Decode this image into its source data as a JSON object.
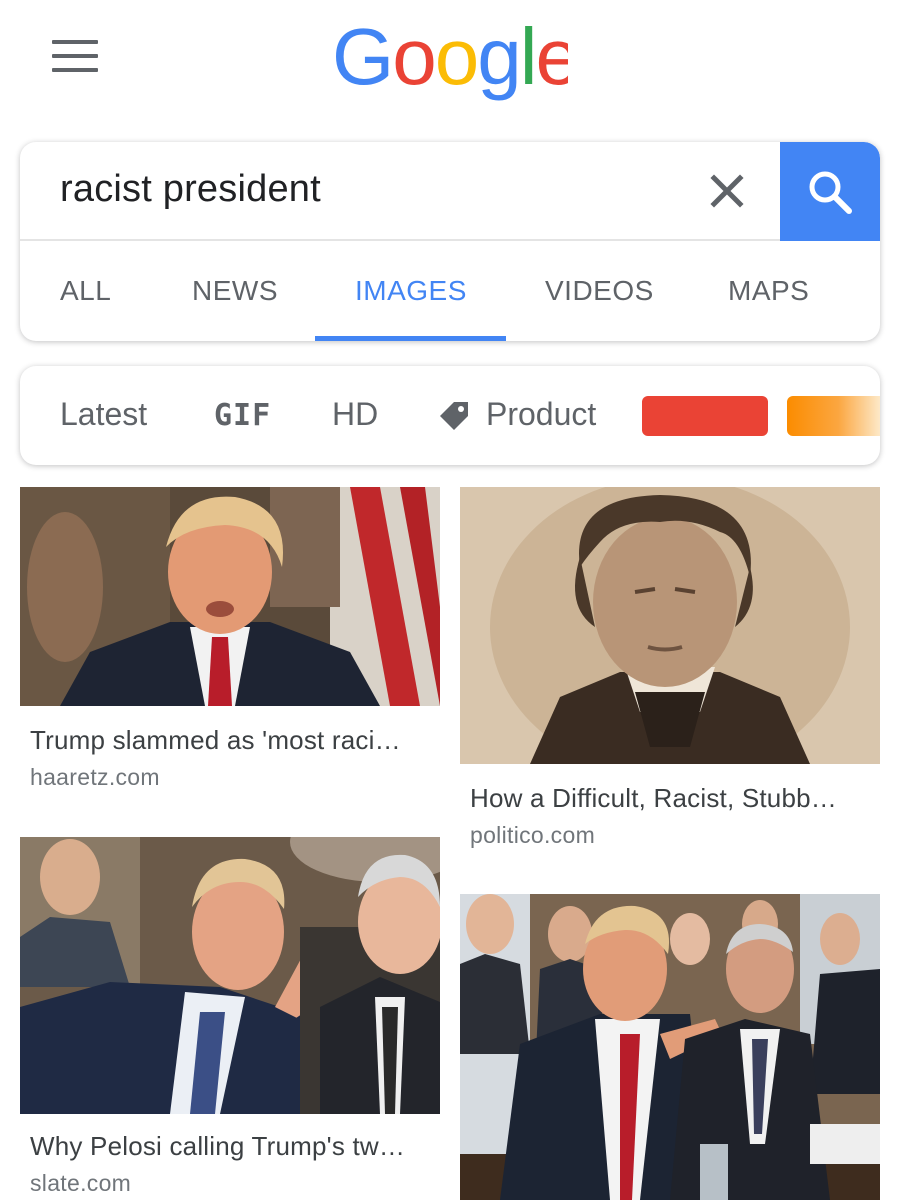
{
  "header": {
    "logo_text": "Google",
    "logo_colors": [
      "#4285F4",
      "#EA4335",
      "#FBBC05",
      "#4285F4",
      "#34A853",
      "#EA4335"
    ]
  },
  "search": {
    "query": "racist president",
    "clear_icon": "close-icon",
    "search_icon": "magnifier-icon",
    "accent_color": "#4285f4"
  },
  "tabs": [
    {
      "label": "ALL",
      "active": false
    },
    {
      "label": "NEWS",
      "active": false
    },
    {
      "label": "IMAGES",
      "active": true
    },
    {
      "label": "VIDEOS",
      "active": false
    },
    {
      "label": "MAPS",
      "active": false
    }
  ],
  "filters": {
    "latest": "Latest",
    "gif": "GIF",
    "hd": "HD",
    "product": "Product",
    "product_icon": "tag-icon",
    "color_chips": [
      "#ea4335",
      "#fb8c00"
    ]
  },
  "results": [
    {
      "title": "Trump slammed as 'most raci…",
      "source": "haaretz.com"
    },
    {
      "title": "How a Difficult, Racist, Stubb…",
      "source": "politico.com"
    },
    {
      "title": "Why Pelosi calling Trump's tw…",
      "source": "slate.com"
    },
    {
      "title": "",
      "source": ""
    }
  ]
}
